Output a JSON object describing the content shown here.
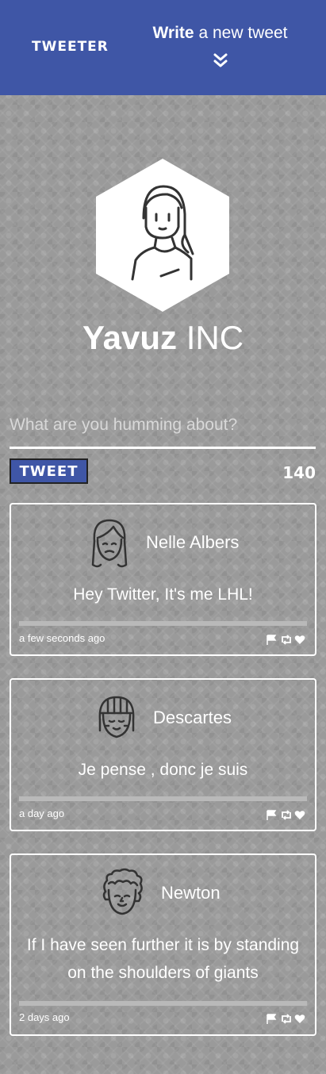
{
  "nav": {
    "brand": "TWEETER",
    "compose_bold": "Write",
    "compose_rest": " a new tweet"
  },
  "profile": {
    "name_first": "Yavuz",
    "name_last": " INC"
  },
  "composer": {
    "placeholder": "What are you humming about?",
    "button_label": "TWEET",
    "counter": "140"
  },
  "tweets": [
    {
      "author": "Nelle Albers",
      "content": "Hey Twitter, It's me LHL!",
      "time": "a few seconds ago",
      "avatar": "woman-avatar-icon"
    },
    {
      "author": "Descartes",
      "content": "Je pense , donc je suis",
      "time": "a day ago",
      "avatar": "girl-bangs-avatar-icon"
    },
    {
      "author": "Newton",
      "content": "If I have seen further it is by standing on the shoulders of giants",
      "time": "2 days ago",
      "avatar": "curly-hair-avatar-icon"
    }
  ],
  "colors": {
    "nav_bg": "#3f56a6",
    "page_bg": "#9a9a9a",
    "text": "#ffffff"
  }
}
